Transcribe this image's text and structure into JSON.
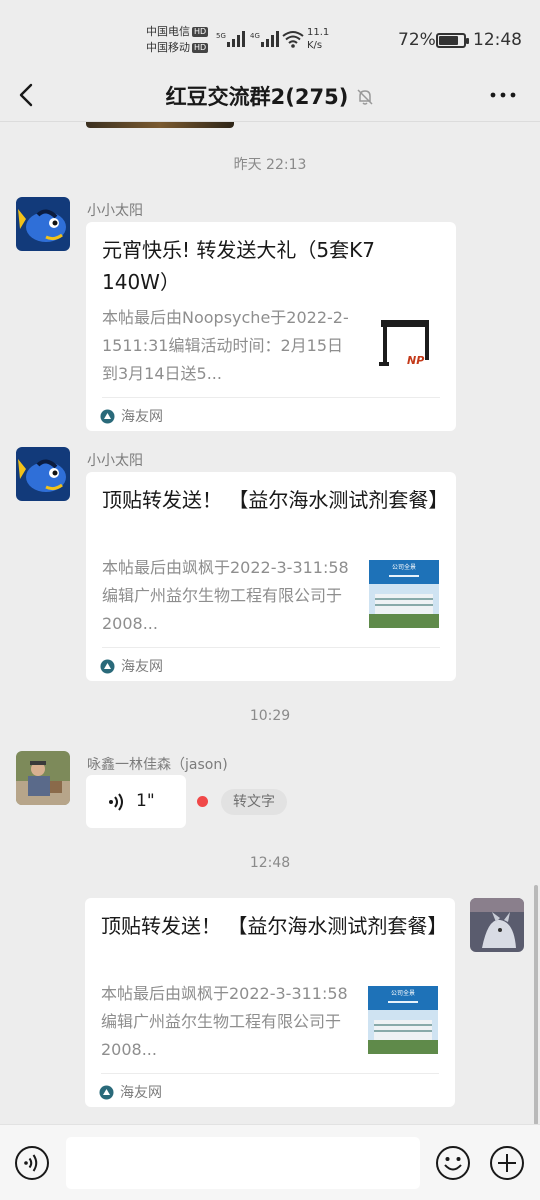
{
  "status_bar": {
    "carrier1": "中国电信",
    "carrier2": "中国移动",
    "hd": "HD",
    "net1": "5G",
    "net2": "4G",
    "speed_value": "11.1",
    "speed_unit": "K/s",
    "battery": "72%",
    "battery_level": 0.72,
    "time": "12:48"
  },
  "header": {
    "title": "红豆交流群2(275)",
    "back_icon": "chevron-left-icon",
    "mute_icon": "bell-off-icon",
    "more_icon": "more-dots-icon"
  },
  "messages": {
    "ts1": "昨天 22:13",
    "m1": {
      "sender": "小小太阳",
      "title": "元宵快乐! 转发送大礼（5套K7 140W）",
      "desc": "本帖最后由Noopsyche于2022-2-1511:31编辑活动时间：2月15日到3月14日送5...",
      "source": "海友网"
    },
    "m2": {
      "sender": "小小太阳",
      "title": "顶贴转发送！ 【益尔海水测试剂套餐】",
      "desc": "本帖最后由飒枫于2022-3-311:58编辑广州益尔生物工程有限公司于2008...",
      "source": "海友网",
      "thumb_text": "公司全景"
    },
    "ts2": "10:29",
    "m3": {
      "sender": "咏鑫一林佳森（jason)",
      "voice_length": "1\"",
      "to_text": "转文字"
    },
    "ts3": "12:48",
    "m4": {
      "title": "顶贴转发送！ 【益尔海水测试剂套餐】",
      "desc": "本帖最后由飒枫于2022-3-311:58编辑广州益尔生物工程有限公司于2008...",
      "source": "海友网",
      "thumb_text": "公司全景"
    }
  },
  "bottom_bar": {
    "voice_icon": "voice-input-icon",
    "emoji_icon": "emoji-icon",
    "plus_icon": "plus-icon"
  },
  "colors": {
    "background": "#ededed",
    "bubble": "#ffffff",
    "unread": "#f04848",
    "source_icon": "#2a6a7a"
  }
}
